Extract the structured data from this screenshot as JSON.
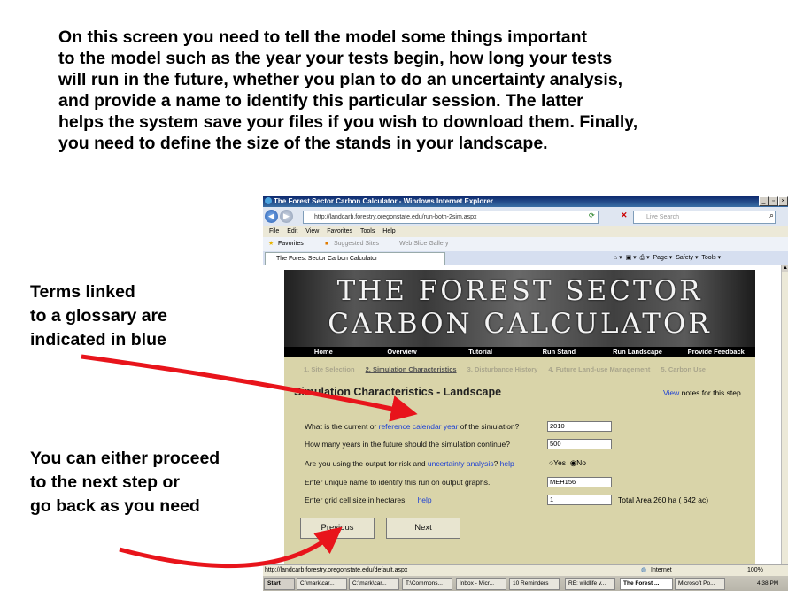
{
  "slide": {
    "intro_lines": [
      "On this screen you need to tell the model some things important",
      "to the model such as the year your tests begin, how long your tests",
      "will run in the future, whether you plan to do an uncertainty analysis,",
      "and provide a name to identify this particular session.  The latter",
      "helps the system save your files if you wish to download them. Finally,",
      "you need to define the size of the stands in your landscape."
    ],
    "note_glossary": [
      "Terms linked",
      "to a glossary are",
      "indicated in blue"
    ],
    "note_proceed": [
      "You can either proceed",
      "to the next step or",
      "go back as you need"
    ],
    "arrow_color": "#e8141b"
  },
  "browser": {
    "window_title": "The Forest Sector Carbon Calculator - Windows Internet Explorer",
    "url": "http://landcarb.forestry.oregonstate.edu/run-both-2sim.aspx",
    "search_placeholder": "Live Search",
    "menu": [
      "File",
      "Edit",
      "View",
      "Favorites",
      "Tools",
      "Help"
    ],
    "favorites_label": "Favorites",
    "suggested_sites": "Suggested Sites",
    "web_slice": "Web Slice Gallery",
    "tab_title": "The Forest Sector Carbon Calculator",
    "commands": [
      "Page",
      "Safety",
      "Tools"
    ],
    "status_url": "http://landcarb.forestry.oregonstate.edu/default.aspx",
    "status_zone": "Internet",
    "zoom": "100%"
  },
  "page": {
    "banner_line1": "THE FOREST SECTOR",
    "banner_line2": "CARBON CALCULATOR",
    "nav": [
      "Home",
      "Overview",
      "Tutorial",
      "Run Stand",
      "Run Landscape",
      "Provide Feedback"
    ],
    "steps": [
      "1. Site Selection",
      "2. Simulation Characteristics",
      "3. Disturbance History",
      "4. Future Land-use Management",
      "5. Carbon Use"
    ],
    "title": "Simulation Characteristics - Landscape",
    "view_link": "View",
    "view_rest": " notes for this step",
    "q1_pre": "What is the current or ",
    "q1_link": "reference calendar year",
    "q1_post": " of the simulation?",
    "q1_value": "2010",
    "q2": "How many years in the future should the simulation continue?",
    "q2_value": "500",
    "q3_pre": "Are you using the output for risk and ",
    "q3_link": "uncertainty analysis",
    "q3_mid": "?  ",
    "q3_help": "help",
    "q3_yes": "Yes",
    "q3_no": "No",
    "q4": "Enter unique name to identify this run on output graphs.",
    "q4_value": "MEH156",
    "q5": "Enter grid cell size in hectares.",
    "q5_help": "help",
    "q5_value": "1",
    "total_area": "Total Area  260  ha ( 642  ac)",
    "previous_button": "Previous",
    "next_button": "Next"
  },
  "taskbar": {
    "start": "Start",
    "items": [
      "C:\\mark\\car...",
      "C:\\mark\\car...",
      "T:\\Commons...",
      "Inbox - Micr...",
      "10 Reminders",
      "RE: wildlife v...",
      "The Forest ...",
      "Microsoft Po..."
    ],
    "clock": "4:38 PM"
  }
}
